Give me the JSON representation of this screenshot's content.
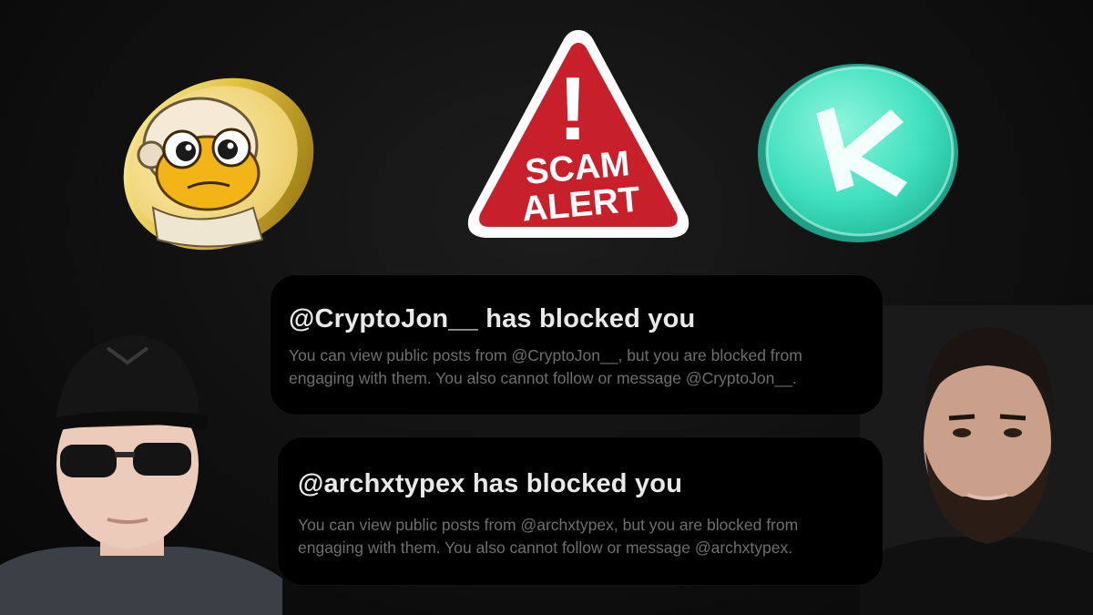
{
  "scam_sign": {
    "line1": "SCAM",
    "line2": "ALERT",
    "mark": "!",
    "color": "#c8202a"
  },
  "coins": [
    {
      "icon": "frog-astronaut-coin-icon"
    },
    {
      "icon": "kaspa-coin-icon",
      "color": "#3fe0bf"
    }
  ],
  "notices": [
    {
      "title": "@CryptoJon__ has blocked you",
      "body": "You can view public posts from @CryptoJon__, but you are blocked from\nengaging with them. You also cannot follow or message @CryptoJon__."
    },
    {
      "title": "@archxtypex has blocked you",
      "body": "You can view public posts from @archxtypex, but you are blocked from\nengaging with them. You also cannot follow or message @archxtypex."
    }
  ],
  "people": [
    {
      "icon": "man-with-cap-and-sunglasses-photo"
    },
    {
      "icon": "bearded-man-photo"
    }
  ]
}
